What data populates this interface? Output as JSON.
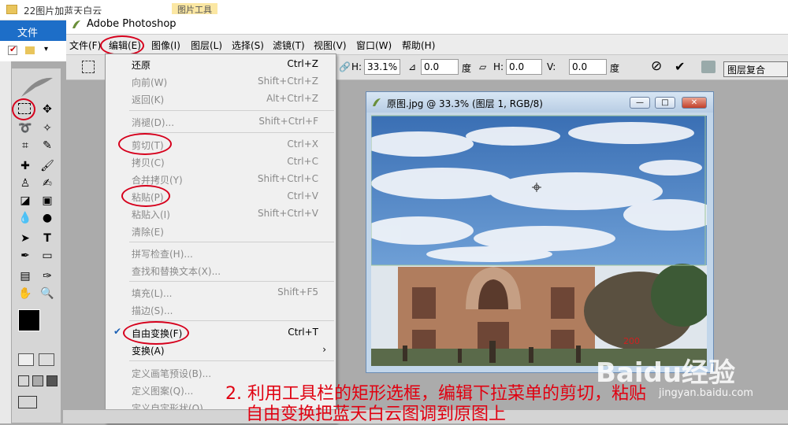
{
  "explorer": {
    "folder_title": "22图片加蓝天白云",
    "badge": "图片工具",
    "file_ribbon": "文件"
  },
  "photoshop": {
    "title": "Adobe Photoshop",
    "menus": [
      "文件(F)",
      "编辑(E)",
      "图像(I)",
      "图层(L)",
      "选择(S)",
      "滤镜(T)",
      "视图(V)",
      "窗口(W)",
      "帮助(H)"
    ]
  },
  "options": {
    "h_label": "H:",
    "h_value": "33.1%",
    "angle_value": "0.0",
    "deg1": "度",
    "skew_h_label": "H:",
    "skew_h_value": "0.0",
    "deg2": "度",
    "skew_v_label": "V:",
    "skew_v_value": "0.0",
    "layer_tab": "图层复合"
  },
  "edit_menu": {
    "items": [
      {
        "label": "还原",
        "shortcut": "Ctrl+Z",
        "disabled": false
      },
      {
        "label": "向前(W)",
        "shortcut": "Shift+Ctrl+Z",
        "disabled": true
      },
      {
        "label": "返回(K)",
        "shortcut": "Alt+Ctrl+Z",
        "disabled": true
      },
      {
        "label": "消褪(D)...",
        "shortcut": "Shift+Ctrl+F",
        "disabled": true
      },
      {
        "label": "剪切(T)",
        "shortcut": "Ctrl+X",
        "disabled": true
      },
      {
        "label": "拷贝(C)",
        "shortcut": "Ctrl+C",
        "disabled": true
      },
      {
        "label": "合并拷贝(Y)",
        "shortcut": "Shift+Ctrl+C",
        "disabled": true
      },
      {
        "label": "粘贴(P)",
        "shortcut": "Ctrl+V",
        "disabled": true
      },
      {
        "label": "粘贴入(I)",
        "shortcut": "Shift+Ctrl+V",
        "disabled": true
      },
      {
        "label": "清除(E)",
        "shortcut": "",
        "disabled": true
      },
      {
        "label": "拼写检查(H)...",
        "shortcut": "",
        "disabled": true
      },
      {
        "label": "查找和替换文本(X)...",
        "shortcut": "",
        "disabled": true
      },
      {
        "label": "填充(L)...",
        "shortcut": "Shift+F5",
        "disabled": true
      },
      {
        "label": "描边(S)...",
        "shortcut": "",
        "disabled": true
      },
      {
        "label": "自由变换(F)",
        "shortcut": "Ctrl+T",
        "disabled": false
      },
      {
        "label": "变换(A)",
        "shortcut": "",
        "disabled": false
      },
      {
        "label": "定义画笔预设(B)...",
        "shortcut": "",
        "disabled": true
      },
      {
        "label": "定义图案(Q)...",
        "shortcut": "",
        "disabled": true
      },
      {
        "label": "定义自定形状(O)...",
        "shortcut": "",
        "disabled": true
      }
    ],
    "submenu_arrow": "›"
  },
  "document": {
    "title": "原图.jpg @ 33.3% (图层 1, RGB/8)",
    "minimize": "—",
    "maximize": "□",
    "close": "✕"
  },
  "caption": {
    "line1": "2. 利用工具栏的矩形选框，编辑下拉菜单的剪切，粘贴",
    "line2": "自由变换把蓝天白云图调到原图上"
  },
  "watermark": {
    "brand": "Baidu经验",
    "url": "jingyan.baidu.com"
  },
  "icons": {
    "checkmark": "✔",
    "commit": "✔",
    "cancel": "⊘"
  }
}
